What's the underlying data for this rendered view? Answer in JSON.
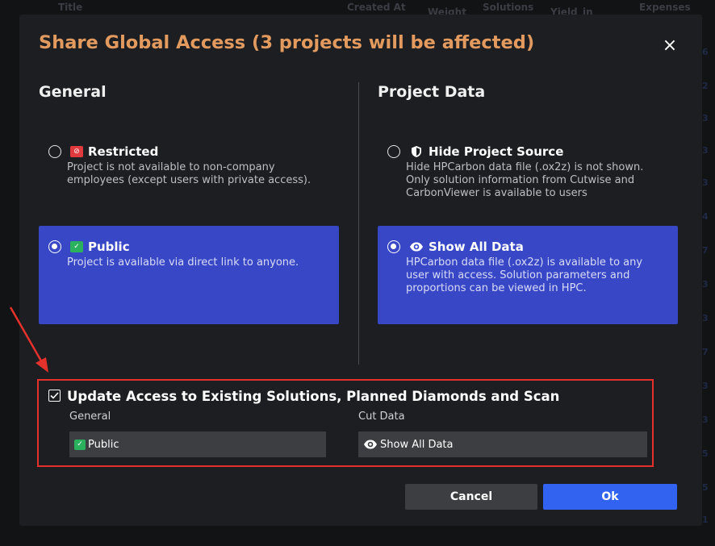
{
  "background_table": {
    "headers": [
      "Title",
      "Created At",
      "Weight",
      "Solutions",
      "Yield",
      "in",
      "Expenses"
    ],
    "right_column_values": [
      "6",
      "2",
      "3",
      "3",
      "3",
      "4",
      "7",
      "3",
      "3",
      "7",
      "3",
      "3",
      "5",
      "5",
      "1"
    ]
  },
  "modal": {
    "title": "Share Global Access (3 projects will be affected)",
    "close_symbol": "×",
    "general": {
      "heading": "General",
      "options": [
        {
          "label": "Restricted",
          "description": "Project is not available to non-company employees (except users with private access).",
          "badge_icon": "restricted-badge-icon",
          "selected": false
        },
        {
          "label": "Public",
          "description": "Project is available via direct link to anyone.",
          "badge_icon": "public-check-badge-icon",
          "selected": true
        }
      ]
    },
    "project_data": {
      "heading": "Project Data",
      "options": [
        {
          "label": "Hide Project Source",
          "description": "Hide HPCarbon data file (.ox2z) is not shown. Only solution information from Cutwise and CarbonViewer is available to users",
          "icon": "shield-icon",
          "selected": false
        },
        {
          "label": "Show All Data",
          "description": "HPCarbon data file (.ox2z) is available to any user with access. Solution parameters and proportions can be viewed in HPC.",
          "icon": "eye-icon",
          "selected": true
        }
      ]
    },
    "update": {
      "checked": true,
      "label": "Update Access to Existing Solutions, Planned Diamonds and Scan",
      "general_label": "General",
      "general_value": "Public",
      "cut_data_label": "Cut Data",
      "cut_data_value": "Show All Data"
    },
    "buttons": {
      "cancel": "Cancel",
      "ok": "Ok"
    }
  },
  "colors": {
    "title_orange": "#e29a5f",
    "selected_blue": "#3747c6",
    "ok_blue": "#3262f0",
    "highlight_red": "#e5312b",
    "restricted_red": "#e0393e",
    "public_green": "#2bb05e"
  }
}
